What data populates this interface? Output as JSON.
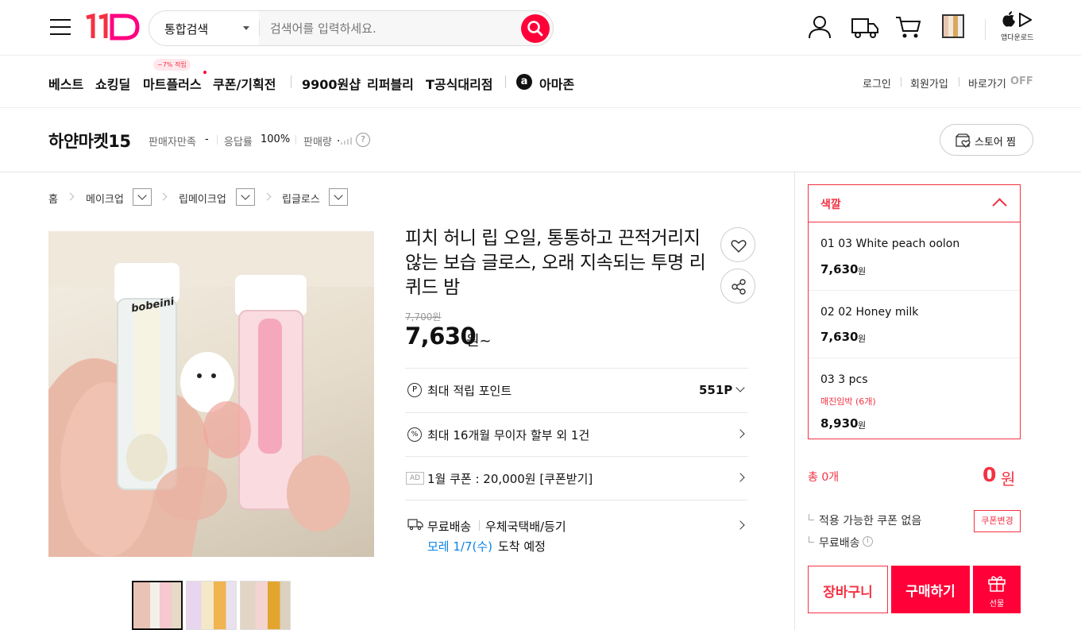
{
  "header": {
    "logo": "11",
    "search_category": "통합검색",
    "search_placeholder": "검색어를 입력하세요.",
    "app_download": "앱다운로드"
  },
  "nav": {
    "items": [
      "베스트",
      "쇼킹딜",
      "마트플러스",
      "쿠폰/기획전",
      "9900원샵",
      "리퍼블리",
      "T공식대리점",
      "아마존"
    ],
    "mart_badge": "~7% 적립",
    "login": "로그인",
    "signup": "회원가입",
    "shortcut": "바로가기",
    "shortcut_state": "OFF"
  },
  "store": {
    "name": "하얀마켓15",
    "satisfaction_label": "판매자만족",
    "satisfaction_value": "-",
    "response_label": "응답률",
    "response_value": "100%",
    "sales_label": "판매량",
    "sales_value": ".",
    "follow": "스토어 찜"
  },
  "breadcrumb": [
    "홈",
    "메이크업",
    "립메이크업",
    "립글로스"
  ],
  "product": {
    "title": "피치 허니 립 오일, 통통하고 끈적거리지 않는 보습 글로스, 오래 지속되는 투명 리퀴드 밤",
    "original_price": "7,700원",
    "price": "7,630",
    "price_suffix": "원~",
    "points_label": "최대 적립 포인트",
    "points_value": "551P",
    "installment": "최대 16개월 무이자 할부 외 1건",
    "ad_tag": "AD",
    "coupon": "1월 쿠폰 : 20,000원 [쿠폰받기]",
    "shipping_free": "무료배송",
    "shipping_method": "우체국택배/등기",
    "arrival_date": "모레 1/7(수)",
    "arrival_suffix": "도착 예정"
  },
  "gallery": {
    "brand_text": "bobeini"
  },
  "options": {
    "header": "색깔",
    "items": [
      {
        "name": "01 03 White peach oolon",
        "price": "7,630",
        "unit": "원",
        "note": ""
      },
      {
        "name": "02 02 Honey milk",
        "price": "7,630",
        "unit": "원",
        "note": ""
      },
      {
        "name": "03 3 pcs",
        "price": "8,930",
        "unit": "원",
        "note": "매진임박 (6개)"
      }
    ]
  },
  "summary": {
    "total_label": "총 0개",
    "total_price": "0",
    "total_unit": "원",
    "coupon_none": "적용 가능한 쿠폰 없음",
    "coupon_change": "쿠폰변경",
    "free_shipping": "무료배송"
  },
  "actions": {
    "cart": "장바구니",
    "buy": "구매하기",
    "gift": "선물"
  },
  "colors": {
    "brand_red": "#f43142",
    "brand_pink": "#ff0038",
    "link_blue": "#0b83e6"
  }
}
